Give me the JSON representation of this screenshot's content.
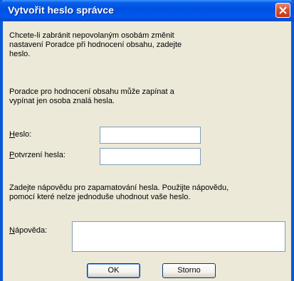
{
  "window": {
    "title": "Vytvořit heslo správce"
  },
  "intro": {
    "line1": "Chcete-li zabránit nepovolaným osobám změnit",
    "line2": "nastavení Poradce při hodnocení obsahu, zadejte",
    "line3": "heslo."
  },
  "note": {
    "line1": "Poradce pro hodnocení obsahu může zapínat a",
    "line2": "vypínat jen osoba znalá hesla."
  },
  "fields": {
    "password": {
      "label_key": "H",
      "label_rest": "eslo:",
      "value": ""
    },
    "confirm": {
      "label_key": "P",
      "label_rest": "otvrzení hesla:",
      "value": ""
    }
  },
  "hint_text": {
    "line1": "Zadejte nápovědu pro zapamatování hesla. Použijte nápovědu,",
    "line2": "pomocí které nelze jednoduše uhodnout vaše heslo."
  },
  "hint_field": {
    "label_key": "N",
    "label_rest": "ápověda:",
    "value": ""
  },
  "buttons": {
    "ok": "OK",
    "cancel": "Storno"
  },
  "colors": {
    "title_bar": "#0054e3",
    "dialog_bg": "#ece9d8",
    "close_button": "#d6502e"
  }
}
